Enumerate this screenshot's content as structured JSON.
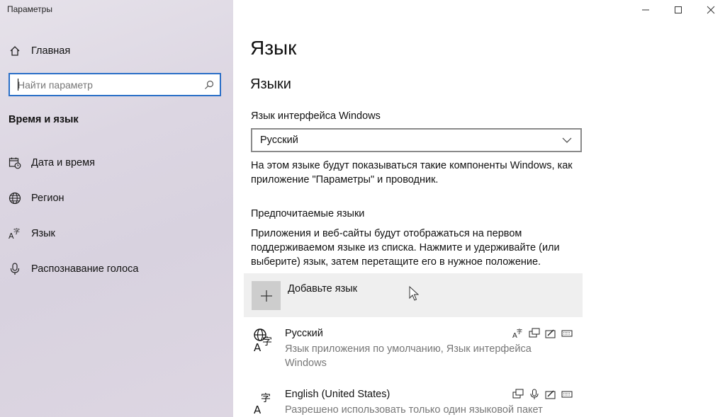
{
  "window": {
    "app_title": "Параметры",
    "controls": [
      "minimize",
      "maximize",
      "close"
    ]
  },
  "sidebar": {
    "home_label": "Главная",
    "search_placeholder": "Найти параметр",
    "section_label": "Время и язык",
    "items": [
      {
        "label": "Дата и время",
        "icon": "calendar-clock-icon"
      },
      {
        "label": "Регион",
        "icon": "globe-icon"
      },
      {
        "label": "Язык",
        "icon": "language-icon"
      },
      {
        "label": "Распознавание голоса",
        "icon": "microphone-icon"
      }
    ]
  },
  "main": {
    "title": "Язык",
    "languages_heading": "Языки",
    "ui_language_label": "Язык интерфейса Windows",
    "ui_language_value": "Русский",
    "ui_language_desc": "На этом языке будут показываться такие компоненты Windows, как приложение \"Параметры\" и проводник.",
    "preferred_heading": "Предпочитаемые языки",
    "preferred_desc": "Приложения и веб-сайты будут отображаться на первом поддерживаемом языке из списка. Нажмите и удерживайте (или выберите) язык, затем перетащите его в нужное положение.",
    "add_language_label": "Добавьте язык",
    "languages": [
      {
        "name": "Русский",
        "description": "Язык приложения по умолчанию, Язык интерфейса Windows",
        "features": [
          "language-pack-icon",
          "text-to-speech-icon",
          "handwriting-icon",
          "keyboard-icon"
        ]
      },
      {
        "name": "English (United States)",
        "description": "Разрешено использовать только один языковой пакет",
        "features": [
          "text-to-speech-icon",
          "speech-icon",
          "handwriting-icon",
          "keyboard-icon"
        ]
      }
    ]
  },
  "colors": {
    "accent": "#2a6fc7",
    "sidebar_bg": "#dcd6e2",
    "highlight_row": "#efefef",
    "secondary_text": "#777777"
  }
}
